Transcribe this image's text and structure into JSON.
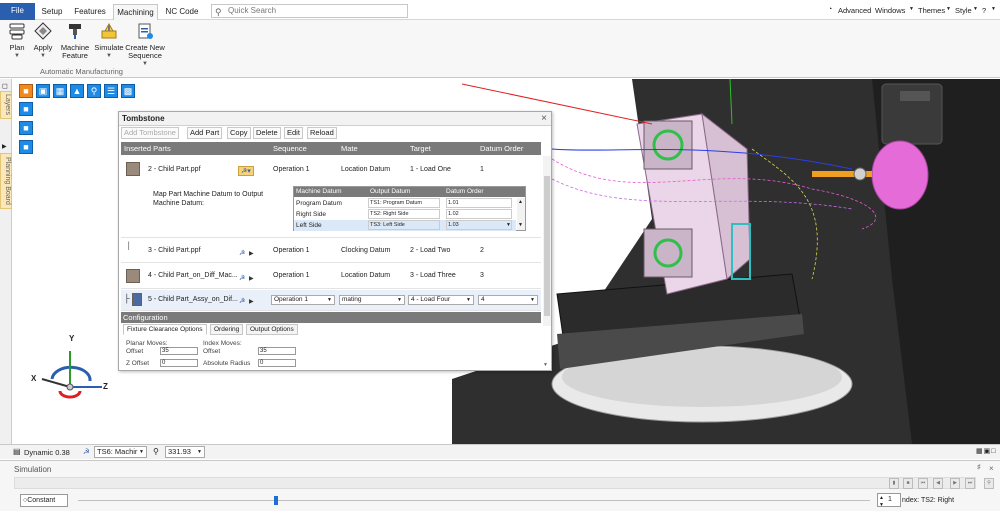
{
  "menubar": {
    "tabs": [
      "File",
      "Setup",
      "Features",
      "Machining",
      "NC Code"
    ],
    "active_tab": "Machining",
    "search_placeholder": "Quick Search",
    "right_items": [
      "Advanced",
      "Windows",
      "Themes",
      "Style"
    ]
  },
  "ribbon": {
    "buttons": [
      {
        "label": "Plan",
        "icon": "plan-icon"
      },
      {
        "label": "Apply",
        "icon": "apply-icon"
      },
      {
        "label": "Machine Feature",
        "icon": "machine-feature-icon"
      },
      {
        "label": "Simulate",
        "icon": "simulate-icon"
      },
      {
        "label": "Create New Sequence",
        "icon": "create-sequence-icon"
      }
    ],
    "group_label": "Automatic Manufacturing"
  },
  "left_tabs": [
    "Layers",
    "Planning Board"
  ],
  "tombstone": {
    "title": "Tombstone",
    "toolbar": [
      "Add Tombstone",
      "Add Part",
      "Copy",
      "Delete",
      "Edit",
      "Reload"
    ],
    "columns": [
      "Inserted Parts",
      "Sequence",
      "Mate",
      "Target",
      "Datum Order"
    ],
    "rows": [
      {
        "part": "2 - Child Part.ppf",
        "sequence": "Operation 1",
        "mate": "Location Datum",
        "target": "1 - Load One",
        "datum_order": "1"
      },
      {
        "part": "3 - Child Part.ppf",
        "sequence": "Operation 1",
        "mate": "Clocking Datum",
        "target": "2 - Load Two",
        "datum_order": "2"
      },
      {
        "part": "4 - Child Part_on_Diff_Mac...",
        "sequence": "Operation 1",
        "mate": "Location Datum",
        "target": "3 - Load Three",
        "datum_order": "3"
      },
      {
        "part": "5 - Child Part_Assy_on_Dif...",
        "sequence": "Operation 1",
        "mate": "mating",
        "target": "4 - Load Four",
        "datum_order": "4"
      }
    ],
    "map_label": "Map Part Machine Datum to Output Machine Datum:",
    "datum_table": {
      "columns": [
        "Machine Datum",
        "Output Datum",
        "Datum Order"
      ],
      "rows": [
        {
          "machine": "Program Datum",
          "output": "TS1: Program Datum",
          "order": "1.01"
        },
        {
          "machine": "Right Side",
          "output": "TS2: Right Side",
          "order": "1.02"
        },
        {
          "machine": "Left Side",
          "output": "TS3: Left Side",
          "order": "1.03"
        }
      ]
    },
    "configuration": {
      "title": "Configuration",
      "tabs": [
        "Fixture Clearance Options",
        "Ordering",
        "Output Options"
      ],
      "planar_moves": "Planar Moves:",
      "index_moves": "Index Moves:",
      "offset_label": "Offset",
      "planar_offset": "35",
      "index_offset": "35",
      "z_offset_label": "Z Offset",
      "z_offset": "0",
      "abs_radius_label": "Absolute Radius",
      "abs_radius": "0"
    }
  },
  "statusbar": {
    "dynamic": "Dynamic 0.38",
    "machine": "TS6: Machir",
    "value": "331.93"
  },
  "simulation": {
    "title": "Simulation",
    "mode": "Constant",
    "slider_value": 0.25,
    "spinner_value": "1",
    "index_label": "ndex: TS2: Right"
  },
  "axes": {
    "x": "X",
    "y": "Y",
    "z": "Z"
  },
  "colors": {
    "accent": "#2a5fb0",
    "toolbar_icon": "#1e8be6",
    "machine_body": "#2e2e2e",
    "spindle": "#e56bd8"
  }
}
